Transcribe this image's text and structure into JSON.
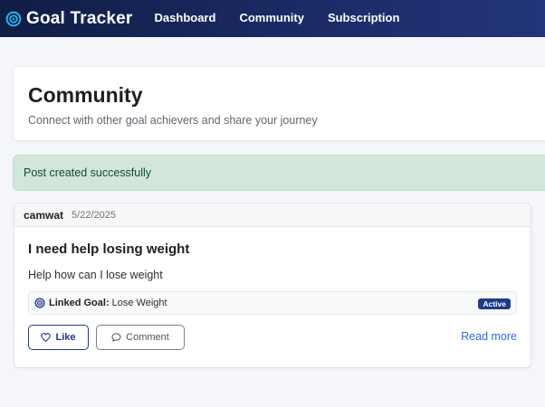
{
  "app": {
    "brand": "Goal Tracker"
  },
  "nav": {
    "items": [
      "Dashboard",
      "Community",
      "Subscription"
    ]
  },
  "page": {
    "title": "Community",
    "subtitle": "Connect with other goal achievers and share your journey"
  },
  "alert": {
    "message": "Post created successfully"
  },
  "post": {
    "author": "camwat",
    "date": "5/22/2025",
    "title": "I need help losing weight",
    "content": "Help how can I lose weight",
    "linked_goal": {
      "label": "Linked Goal:",
      "value": "Lose Weight",
      "status": "Active"
    },
    "actions": {
      "like": "Like",
      "comment": "Comment",
      "read_more": "Read more"
    }
  },
  "icons": {
    "brand": "target-icon",
    "linked_goal": "target-icon",
    "like": "heart-icon",
    "comment": "chat-bubble-icon"
  },
  "colors": {
    "navbar": "#101d45",
    "accent": "#1f3a8a",
    "link": "#2d6be0",
    "alert_bg": "#d2e6db",
    "brand_icon": "#27b3ee"
  }
}
